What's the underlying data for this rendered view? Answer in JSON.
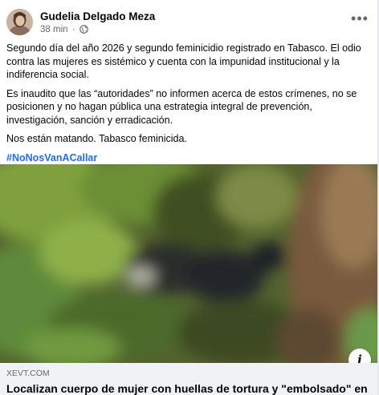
{
  "post": {
    "author": "Gudelia Delgado Meza",
    "time": "38 min",
    "separator": "·",
    "more_label": "•••",
    "paragraphs": [
      "Segundo día del año 2026 y segundo feminicidio registrado en Tabasco. El odio contra las mujeres es sistémico y cuenta con la impunidad institucional y la indiferencia social.",
      "Es inaudito que las “autoridades” no informen acerca de estos crímenes, no se posicionen y no hagan pública una estrategia integral de prevención, investigación, sanción y erradicación.",
      "Nos están matando. Tabasco feminicida."
    ],
    "hashtag": "#NoNosVanACallar"
  },
  "link_preview": {
    "domain": "XEVT.COM",
    "title": "Localizan cuerpo de mujer con huellas de tortura y \"embolsado\" en",
    "info_icon_label": "i"
  },
  "icons": {
    "avatar": "avatar-photo",
    "privacy": "globe-icon",
    "more": "more-options-icon",
    "info": "info-icon"
  },
  "colors": {
    "hashtag": "#216fdb",
    "secondary_text": "#65676b",
    "link_box_bg": "#f0f2f5"
  }
}
